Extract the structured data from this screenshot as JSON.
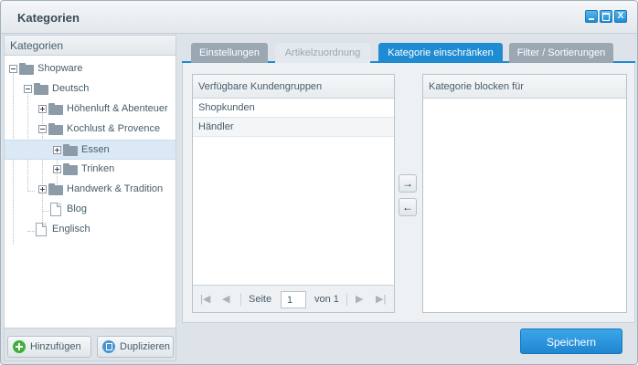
{
  "window": {
    "title": "Kategorien",
    "buttons": {
      "minimize": "minimize",
      "maximize": "maximize",
      "close": "X"
    }
  },
  "sidebar": {
    "header": "Kategorien",
    "tree": [
      {
        "label": "Shopware",
        "icon": "folder-icon",
        "toggle": "minus"
      },
      {
        "label": "Deutsch",
        "icon": "folder-icon",
        "toggle": "minus"
      },
      {
        "label": "Höhenluft & Abenteuer",
        "icon": "folder-icon",
        "toggle": "plus"
      },
      {
        "label": "Kochlust & Provence",
        "icon": "folder-icon",
        "toggle": "minus"
      },
      {
        "label": "Essen",
        "icon": "folder-icon",
        "toggle": "plus",
        "selected": true
      },
      {
        "label": "Trinken",
        "icon": "folder-icon",
        "toggle": "plus"
      },
      {
        "label": "Handwerk & Tradition",
        "icon": "folder-icon",
        "toggle": "plus"
      },
      {
        "label": "Blog",
        "icon": "page-icon"
      },
      {
        "label": "Englisch",
        "icon": "page-icon"
      }
    ],
    "buttons": {
      "add": "Hinzufügen",
      "duplicate": "Duplizieren"
    }
  },
  "tabs": [
    {
      "label": "Einstellungen",
      "state": "inactive"
    },
    {
      "label": "Artikelzuordnung",
      "state": "disabled"
    },
    {
      "label": "Kategorie einschränken",
      "state": "active"
    },
    {
      "label": "Filter / Sortierungen",
      "state": "inactive"
    }
  ],
  "available_groups": {
    "header": "Verfügbare Kundengruppen",
    "rows": [
      "Shopkunden",
      "Händler"
    ],
    "pager": {
      "page_label": "Seite",
      "page_value": "1",
      "of_label": "von 1"
    }
  },
  "blocked_groups": {
    "header": "Kategorie blocken für",
    "rows": []
  },
  "transfer": {
    "add_arrow": "→",
    "remove_arrow": "←"
  },
  "footer": {
    "save": "Speichern"
  },
  "colors": {
    "accent": "#1f8bd3",
    "add_green": "#3fae3c",
    "selected_row": "#dbe9f5"
  }
}
